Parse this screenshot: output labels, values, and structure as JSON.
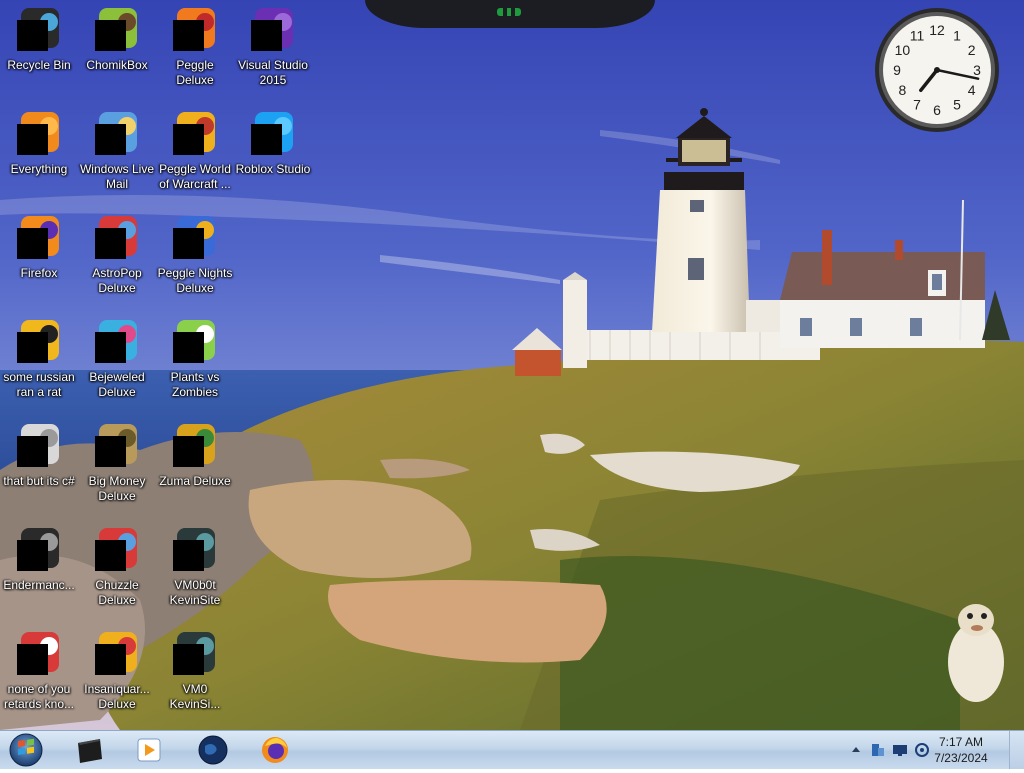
{
  "desktop": {
    "icons": [
      {
        "label": "Recycle Bin",
        "icon": "recycle-bin-icon"
      },
      {
        "label": "ChomikBox",
        "icon": "chomikbox-icon"
      },
      {
        "label": "Peggle Deluxe",
        "icon": "peggle-icon"
      },
      {
        "label": "Visual Studio 2015",
        "icon": "visual-studio-icon"
      },
      {
        "label": "Everything",
        "icon": "everything-search-icon"
      },
      {
        "label": "Windows Live Mail",
        "icon": "mail-icon"
      },
      {
        "label": "Peggle World of Warcraft ...",
        "icon": "peggle-wow-icon"
      },
      {
        "label": "Roblox Studio",
        "icon": "roblox-studio-icon"
      },
      {
        "label": "Firefox",
        "icon": "firefox-icon"
      },
      {
        "label": "AstroPop Deluxe",
        "icon": "astropop-icon"
      },
      {
        "label": "Peggle Nights Deluxe",
        "icon": "peggle-nights-icon"
      },
      {
        "label": "some russian ran a rat",
        "icon": "document-icon"
      },
      {
        "label": "Bejeweled Deluxe",
        "icon": "bejeweled-icon"
      },
      {
        "label": "Plants vs Zombies",
        "icon": "plants-vs-zombies-icon"
      },
      {
        "label": "that but its c#",
        "icon": "files-icon"
      },
      {
        "label": "Big Money Deluxe",
        "icon": "money-bag-icon"
      },
      {
        "label": "Zuma Deluxe",
        "icon": "zuma-icon"
      },
      {
        "label": "Endermanc...",
        "icon": "terminal-icon"
      },
      {
        "label": "Chuzzle Deluxe",
        "icon": "chuzzle-icon"
      },
      {
        "label": "VM0b0t KevinSite",
        "icon": "vm-icon"
      },
      {
        "label": "none of you retards kno...",
        "icon": "app-icon"
      },
      {
        "label": "Insaniquar... Deluxe",
        "icon": "insaniquarium-icon"
      },
      {
        "label": "VM0 KevinSi...",
        "icon": "vm-icon"
      }
    ]
  },
  "clock_gadget": {
    "numerals": [
      "12",
      "1",
      "2",
      "3",
      "4",
      "5",
      "6",
      "7",
      "8",
      "9",
      "10",
      "11"
    ],
    "hour": 7,
    "minute": 17
  },
  "taskbar": {
    "pinned": [
      {
        "name": "start-button",
        "icon": "windows-logo-icon"
      },
      {
        "name": "taskbar-app-1",
        "icon": "dark-box-icon"
      },
      {
        "name": "taskbar-media-player",
        "icon": "media-player-icon"
      },
      {
        "name": "taskbar-globe",
        "icon": "globe-icon"
      },
      {
        "name": "taskbar-firefox",
        "icon": "firefox-icon"
      }
    ],
    "tray": {
      "time": "7:17 AM",
      "date": "7/23/2024"
    }
  },
  "colors": {
    "taskbar_top": "#dce9f6",
    "taskbar_bottom": "#b3c9e2",
    "sky_top": "#3a4db8",
    "sea": "#2a4f9a"
  }
}
